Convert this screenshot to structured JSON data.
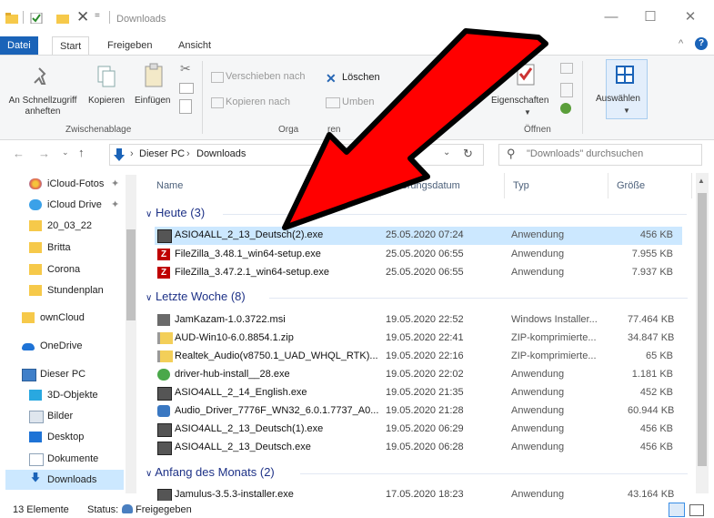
{
  "window": {
    "title": "Downloads",
    "minimize": "—",
    "maximize": "☐",
    "close": "✕"
  },
  "ribbon_tabs": [
    "Datei",
    "Start",
    "Freigeben",
    "Ansicht"
  ],
  "ribbon": {
    "pin_label": "An Schnellzugriff anheften",
    "copy_label": "Kopieren",
    "paste_label": "Einfügen",
    "clipboard_group": "Zwischenablage",
    "move_label": "Verschieben nach",
    "copyto_label": "Kopieren nach",
    "delete_label": "Löschen",
    "rename_label": "Umben",
    "organize_group": "Orga",
    "organize_group_tail": "ren",
    "properties_label": "Eigenschaften",
    "open_group": "Öffnen",
    "select_label": "Auswählen"
  },
  "address": {
    "path": [
      "Dieser PC",
      "Downloads"
    ],
    "search_placeholder": "\"Downloads\" durchsuchen"
  },
  "nav": [
    {
      "label": "iCloud-Fotos",
      "icon": "icloud-photos-icon",
      "pinned": true
    },
    {
      "label": "iCloud Drive",
      "icon": "icloud-drive-icon",
      "pinned": true
    },
    {
      "label": "20_03_22",
      "icon": "folder-icon"
    },
    {
      "label": "Britta",
      "icon": "folder-icon"
    },
    {
      "label": "Corona",
      "icon": "folder-icon"
    },
    {
      "label": "Stundenplan",
      "icon": "folder-icon"
    },
    {
      "label": "ownCloud",
      "icon": "folder-icon"
    },
    {
      "label": "OneDrive",
      "icon": "cloud-icon"
    },
    {
      "label": "Dieser PC",
      "icon": "computer-icon"
    },
    {
      "label": "3D-Objekte",
      "icon": "3d-objects-icon"
    },
    {
      "label": "Bilder",
      "icon": "pictures-icon"
    },
    {
      "label": "Desktop",
      "icon": "desktop-icon"
    },
    {
      "label": "Dokumente",
      "icon": "documents-icon"
    },
    {
      "label": "Downloads",
      "icon": "downloads-icon",
      "selected": true
    }
  ],
  "columns": {
    "name": "Name",
    "date": "Änderungsdatum",
    "type": "Typ",
    "size": "Größe"
  },
  "groups": [
    {
      "label": "Heute (3)",
      "files": [
        {
          "name": "ASIO4ALL_2_13_Deutsch(2).exe",
          "date": "25.05.2020 07:24",
          "type": "Anwendung",
          "size": "456 KB",
          "icon": "installer-icon",
          "selected": true
        },
        {
          "name": "FileZilla_3.48.1_win64-setup.exe",
          "date": "25.05.2020 06:55",
          "type": "Anwendung",
          "size": "7.955 KB",
          "icon": "filezilla-icon"
        },
        {
          "name": "FileZilla_3.47.2.1_win64-setup.exe",
          "date": "25.05.2020 06:55",
          "type": "Anwendung",
          "size": "7.937 KB",
          "icon": "filezilla-icon"
        }
      ]
    },
    {
      "label": "Letzte Woche (8)",
      "files": [
        {
          "name": "JamKazam-1.0.3722.msi",
          "date": "19.05.2020 22:52",
          "type": "Windows Installer...",
          "size": "77.464 KB",
          "icon": "msi-icon"
        },
        {
          "name": "AUD-Win10-6.0.8854.1.zip",
          "date": "19.05.2020 22:41",
          "type": "ZIP-komprimierte...",
          "size": "34.847 KB",
          "icon": "zip-icon"
        },
        {
          "name": "Realtek_Audio(v8750.1_UAD_WHQL_RTK)...",
          "date": "19.05.2020 22:16",
          "type": "ZIP-komprimierte...",
          "size": "65 KB",
          "icon": "zip-icon"
        },
        {
          "name": "driver-hub-install__28.exe",
          "date": "19.05.2020 22:02",
          "type": "Anwendung",
          "size": "1.181 KB",
          "icon": "driver-hub-icon"
        },
        {
          "name": "ASIO4ALL_2_14_English.exe",
          "date": "19.05.2020 21:35",
          "type": "Anwendung",
          "size": "452 KB",
          "icon": "installer-icon"
        },
        {
          "name": "Audio_Driver_7776F_WN32_6.0.1.7737_A0...",
          "date": "19.05.2020 21:28",
          "type": "Anwendung",
          "size": "60.944 KB",
          "icon": "driver-icon"
        },
        {
          "name": "ASIO4ALL_2_13_Deutsch(1).exe",
          "date": "19.05.2020 06:29",
          "type": "Anwendung",
          "size": "456 KB",
          "icon": "installer-icon"
        },
        {
          "name": "ASIO4ALL_2_13_Deutsch.exe",
          "date": "19.05.2020 06:28",
          "type": "Anwendung",
          "size": "456 KB",
          "icon": "installer-icon"
        }
      ]
    },
    {
      "label": "Anfang des Monats (2)",
      "files": [
        {
          "name": "Jamulus-3.5.3-installer.exe",
          "date": "17.05.2020 18:23",
          "type": "Anwendung",
          "size": "43.164 KB",
          "icon": "installer-icon"
        }
      ]
    }
  ],
  "status": {
    "count": "13 Elemente",
    "state_label": "Status:",
    "state_value": "Freigegeben"
  },
  "colors": {
    "accent": "#1a63b8",
    "selection": "#cce8ff",
    "group": "#1e3287",
    "arrow": "#ff0000"
  }
}
